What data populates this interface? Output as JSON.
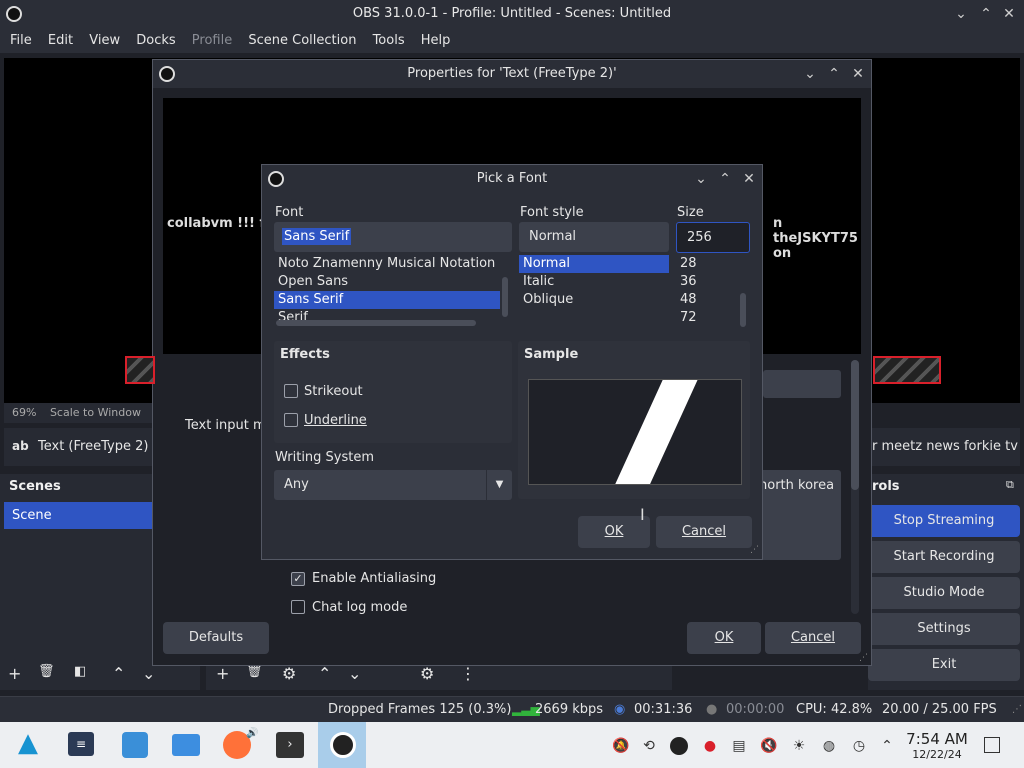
{
  "window": {
    "title": "OBS 31.0.0-1 - Profile: Untitled - Scenes: Untitled"
  },
  "menu": {
    "file": "File",
    "edit": "Edit",
    "view": "View",
    "docks": "Docks",
    "profile": "Profile",
    "scene_collection": "Scene Collection",
    "tools": "Tools",
    "help": "Help"
  },
  "preview": {
    "zoom": "69%",
    "scale_mode": "Scale to Window"
  },
  "source_bar": {
    "name": "Text (FreeType 2)",
    "ticker_right": "r meetz news forkie tv"
  },
  "scenes": {
    "title": "Scenes",
    "items": [
      "Scene"
    ]
  },
  "controls": {
    "title": "rols",
    "stop_streaming": "Stop Streaming",
    "start_recording": "Start Recording",
    "studio_mode": "Studio Mode",
    "settings": "Settings",
    "exit": "Exit"
  },
  "properties": {
    "title": "Properties for 'Text (FreeType 2)'",
    "preview_text_left": "collabvm !!! fork",
    "preview_text_right": "n theJSKYT75 on",
    "text_input_label": "Text input m",
    "text_right": "north korea",
    "antialiasing_label": "Enable Antialiasing",
    "chatlog_label": "Chat log mode",
    "defaults": "Defaults",
    "ok": "OK",
    "cancel": "Cancel"
  },
  "font_dialog": {
    "title": "Pick a Font",
    "font_label": "Font",
    "font_value": "Sans Serif",
    "font_list": [
      "Noto Znamenny Musical Notation",
      "Open Sans",
      "Sans Serif",
      "Serif"
    ],
    "style_label": "Font style",
    "style_value": "Normal",
    "style_list": [
      "Normal",
      "Italic",
      "Oblique"
    ],
    "size_label": "Size",
    "size_value": "256",
    "size_list": [
      "28",
      "36",
      "48",
      "72"
    ],
    "effects_label": "Effects",
    "strikeout": "Strikeout",
    "underline": "Underline",
    "writing_system_label": "Writing System",
    "writing_system_value": "Any",
    "sample_label": "Sample",
    "sample_glyph": "7",
    "ok": "OK",
    "cancel": "Cancel"
  },
  "status": {
    "dropped_frames": "Dropped Frames 125 (0.3%)",
    "bitrate": "2669 kbps",
    "stream_time": "00:31:36",
    "rec_time": "00:00:00",
    "cpu": "CPU: 42.8%",
    "fps": "20.00 / 25.00 FPS"
  },
  "clock": {
    "time": "7:54 AM",
    "date": "12/22/24"
  },
  "colors": {
    "accent": "#2f55c3",
    "danger": "#d9202b",
    "bg": "#1f2128"
  }
}
